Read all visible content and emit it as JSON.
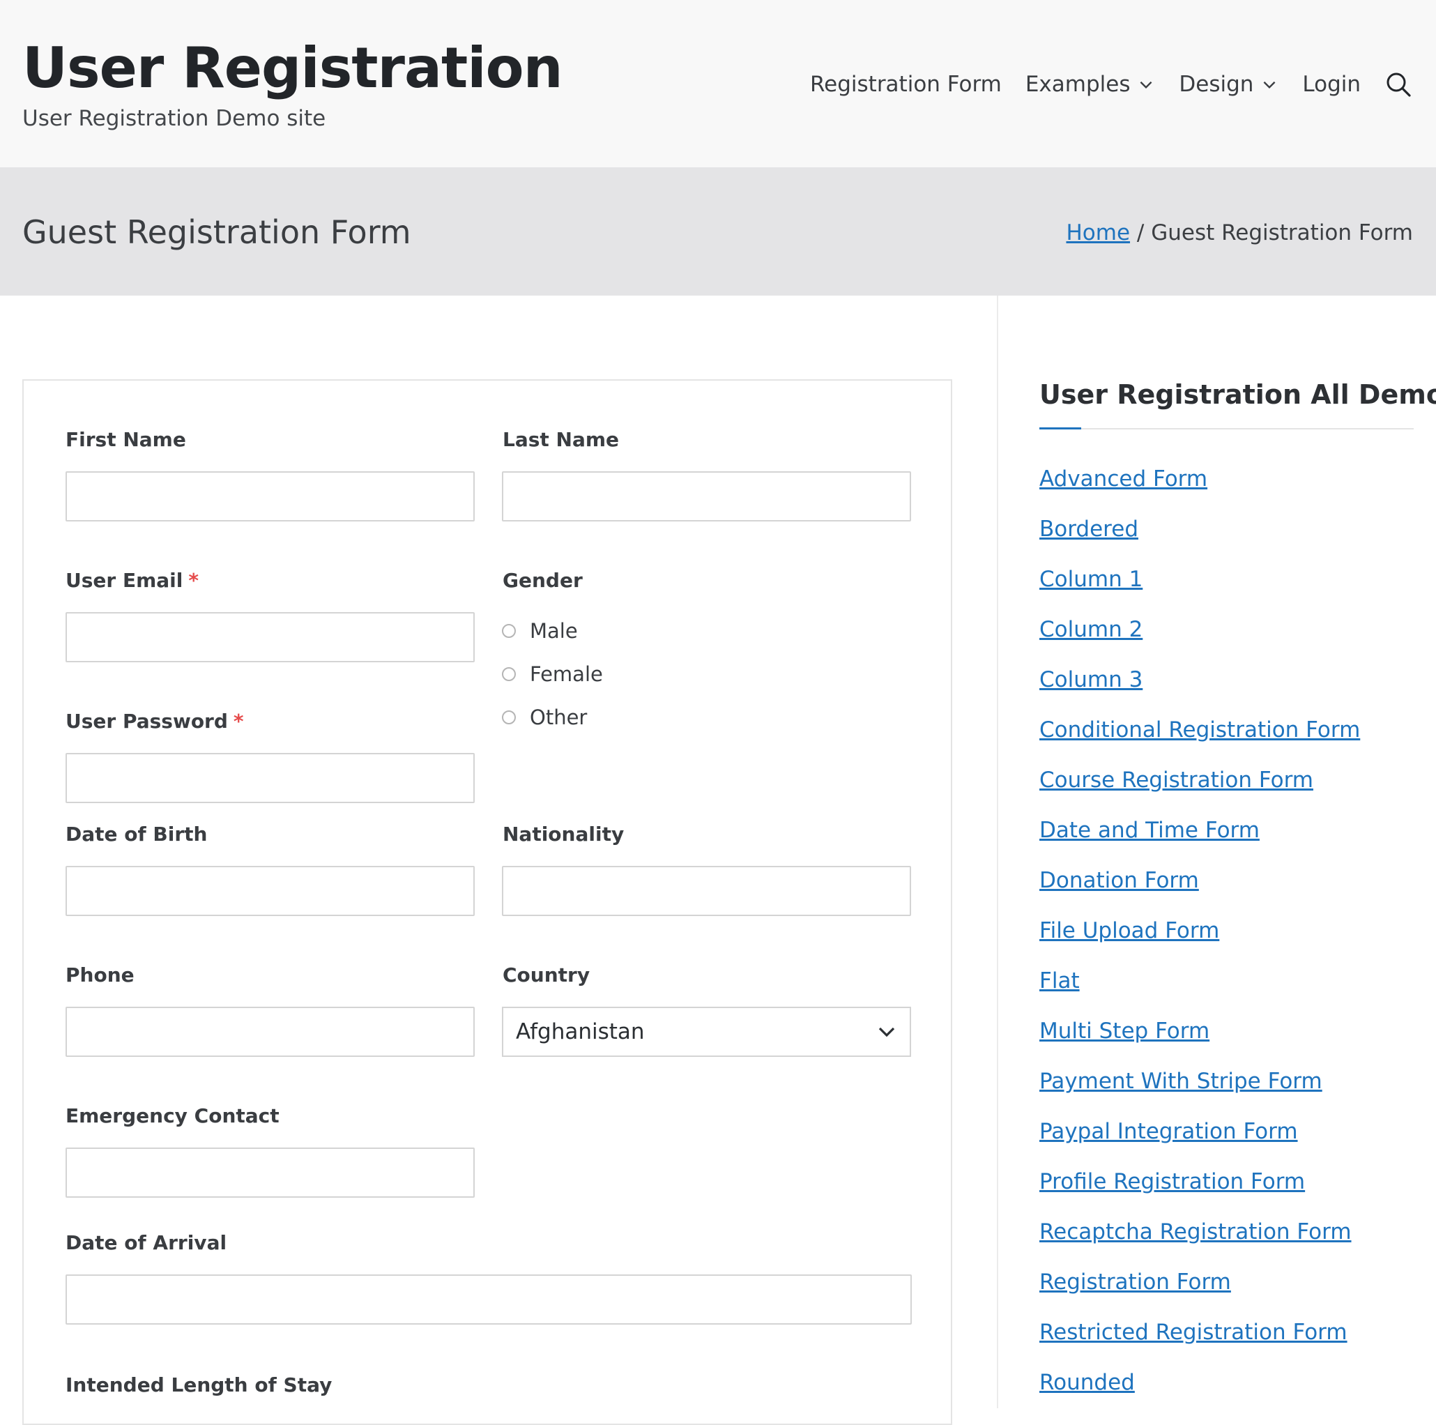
{
  "header": {
    "site_title": "User Registration",
    "tagline": "User Registration Demo site",
    "nav": [
      {
        "label": "Registration Form"
      },
      {
        "label": "Examples"
      },
      {
        "label": "Design"
      },
      {
        "label": "Login"
      }
    ]
  },
  "page": {
    "title": "Guest Registration Form",
    "breadcrumb": {
      "home": "Home",
      "separator": "/",
      "current": "Guest Registration Form"
    }
  },
  "form": {
    "first_name": {
      "label": "First Name",
      "value": ""
    },
    "last_name": {
      "label": "Last Name",
      "value": ""
    },
    "user_email": {
      "label": "User Email",
      "required_mark": "*",
      "value": ""
    },
    "user_password": {
      "label": "User Password",
      "required_mark": "*",
      "value": ""
    },
    "gender": {
      "label": "Gender",
      "options": [
        "Male",
        "Female",
        "Other"
      ]
    },
    "date_of_birth": {
      "label": "Date of Birth",
      "value": ""
    },
    "nationality": {
      "label": "Nationality",
      "value": ""
    },
    "phone": {
      "label": "Phone",
      "value": ""
    },
    "country": {
      "label": "Country",
      "selected": "Afghanistan"
    },
    "emergency_contact": {
      "label": "Emergency Contact",
      "value": ""
    },
    "date_of_arrival": {
      "label": "Date of Arrival",
      "value": ""
    },
    "intended_length_of_stay": {
      "label": "Intended Length of Stay"
    }
  },
  "sidebar": {
    "title": "User Registration All Demos",
    "links": [
      "Advanced Form",
      "Bordered",
      "Column 1",
      "Column 2",
      "Column 3",
      "Conditional Registration Form",
      "Course Registration Form",
      "Date and Time Form",
      "Donation Form",
      "File Upload Form",
      "Flat",
      "Multi Step Form",
      "Payment With Stripe Form",
      "Paypal Integration Form",
      "Profile Registration Form",
      "Recaptcha Registration Form",
      "Registration Form",
      "Restricted Registration Form",
      "Rounded"
    ]
  },
  "colors": {
    "link": "#1e73be",
    "required": "#e64c4c",
    "header_bg": "#f8f8f8",
    "title_bar_bg": "#e4e4e6"
  },
  "icons": [
    "chevron-down-icon",
    "search-icon"
  ]
}
